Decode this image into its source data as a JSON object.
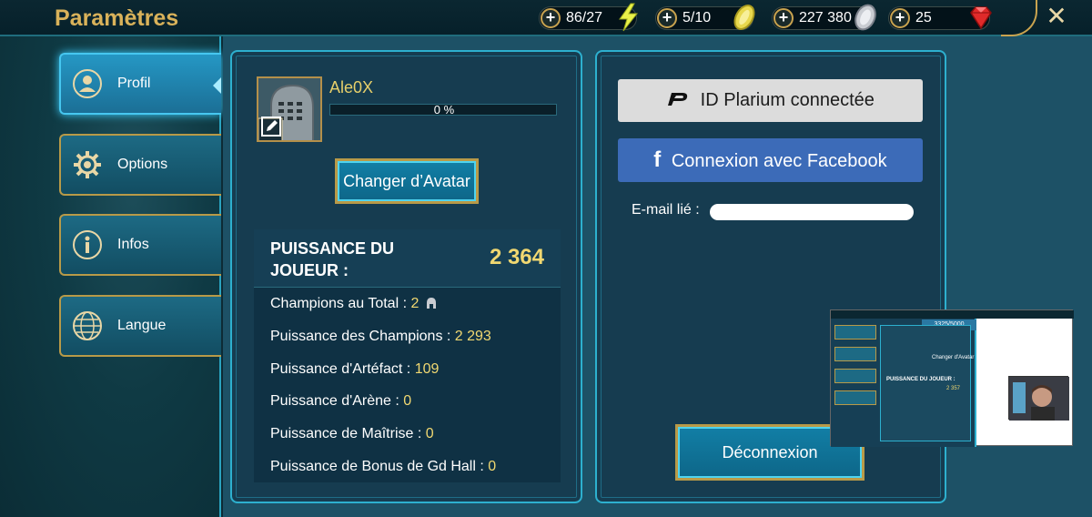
{
  "header": {
    "title": "Paramètres",
    "close_icon": "close-icon",
    "resources": [
      {
        "value": "86/27",
        "icon": "lightning-energy-icon"
      },
      {
        "value": "5/10",
        "icon": "arena-token-icon"
      },
      {
        "value": "227 380",
        "icon": "silver-coin-icon"
      },
      {
        "value": "25",
        "icon": "ruby-gem-icon"
      }
    ]
  },
  "sidebar": {
    "items": [
      {
        "label": "Profil",
        "icon": "user-icon",
        "active": true
      },
      {
        "label": "Options",
        "icon": "gear-icon",
        "active": false
      },
      {
        "label": "Infos",
        "icon": "info-icon",
        "active": false
      },
      {
        "label": "Langue",
        "icon": "globe-icon",
        "active": false
      }
    ]
  },
  "profile": {
    "player_name": "Ale0X",
    "xp_percent_label": "0 %",
    "xp_fraction": 0,
    "change_avatar_label": "Changer d’Avatar",
    "power_title": "PUISSANCE DU JOUEUR :",
    "power_total": "2 364",
    "stats": [
      {
        "label": "Champions au Total :",
        "value": "2"
      },
      {
        "label": "Puissance des Champions :",
        "value": "2 293"
      },
      {
        "label": "Puissance d'Artéfact :",
        "value": "109"
      },
      {
        "label": "Puissance d'Arène :",
        "value": "0"
      },
      {
        "label": "Puissance de Maîtrise :",
        "value": "0"
      },
      {
        "label": "Puissance de Bonus de Gd Hall :",
        "value": "0"
      }
    ]
  },
  "account": {
    "plarium_label": "ID Plarium connectée",
    "facebook_label": "Connexion avec Facebook",
    "email_label": "E-mail lié :",
    "logout_label": "Déconnexion"
  },
  "overlay": {
    "level_badge": "3325/5000",
    "power_title": "PUISSANCE DU JOUEUR :",
    "power_total": "2 357",
    "change_avatar": "Changer d'Avatar"
  },
  "colors": {
    "accent_gold": "#d9b25a",
    "value_yellow": "#f1d871",
    "facebook_blue": "#3c6bb8",
    "panel_border": "#2db0cf"
  }
}
